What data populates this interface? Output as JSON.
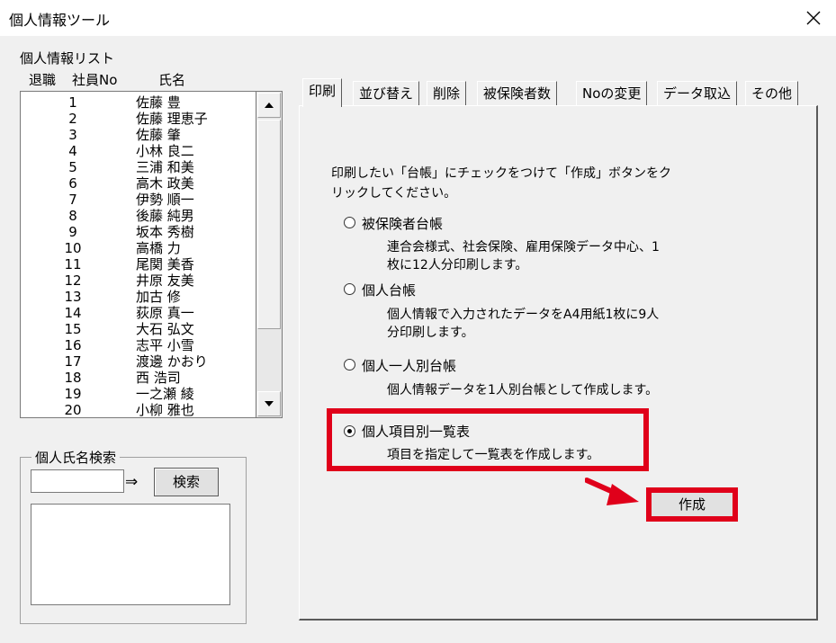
{
  "window": {
    "title": "個人情報ツール"
  },
  "list": {
    "title": "個人情報リスト",
    "columns": [
      "退職",
      "社員No",
      "氏名"
    ],
    "rows": [
      {
        "no": "1",
        "name": "佐藤 豊"
      },
      {
        "no": "2",
        "name": "佐藤 理恵子"
      },
      {
        "no": "3",
        "name": "佐藤 肇"
      },
      {
        "no": "4",
        "name": "小林 良二"
      },
      {
        "no": "5",
        "name": "三浦 和美"
      },
      {
        "no": "6",
        "name": "高木 政美"
      },
      {
        "no": "7",
        "name": "伊勢 順一"
      },
      {
        "no": "8",
        "name": "後藤 純男"
      },
      {
        "no": "9",
        "name": "坂本 秀樹"
      },
      {
        "no": "10",
        "name": "高橋 力"
      },
      {
        "no": "11",
        "name": "尾関 美香"
      },
      {
        "no": "12",
        "name": "井原 友美"
      },
      {
        "no": "13",
        "name": "加古 修"
      },
      {
        "no": "14",
        "name": "荻原 真一"
      },
      {
        "no": "15",
        "name": "大石 弘文"
      },
      {
        "no": "16",
        "name": "志平 小雪"
      },
      {
        "no": "17",
        "name": "渡邊 かおり"
      },
      {
        "no": "18",
        "name": "西 浩司"
      },
      {
        "no": "19",
        "name": "一之瀬 綾"
      },
      {
        "no": "20",
        "name": "小柳 雅也"
      }
    ]
  },
  "search": {
    "group_title": "個人氏名検索",
    "input_value": "",
    "arrow": "⇒",
    "button_label": "検索"
  },
  "tabs": [
    {
      "label": "印刷",
      "active": true
    },
    {
      "label": "並び替え"
    },
    {
      "label": "削除"
    },
    {
      "label": "被保険者数"
    },
    {
      "label": "Noの変更"
    },
    {
      "label": "データ取込"
    },
    {
      "label": "その他"
    }
  ],
  "print_panel": {
    "instruction_line1": "印刷したい「台帳」にチェックをつけて「作成」ボタンをク",
    "instruction_line2": "リックしてください。",
    "options": [
      {
        "label": "被保険者台帳",
        "desc_line1": "連合会様式、社会保険、雇用保険データ中心、1",
        "desc_line2": "枚に12人分印刷します。",
        "selected": false
      },
      {
        "label": "個人台帳",
        "desc_line1": "個人情報で入力されたデータをA4用紙1枚に9人",
        "desc_line2": "分印刷します。",
        "selected": false
      },
      {
        "label": "個人一人別台帳",
        "desc_line1": "個人情報データを1人別台帳として作成します。",
        "desc_line2": "",
        "selected": false
      },
      {
        "label": "個人項目別一覧表",
        "desc_line1": "項目を指定して一覧表を作成します。",
        "desc_line2": "",
        "selected": true
      }
    ],
    "create_button": "作成"
  },
  "colors": {
    "highlight": "#e0001a",
    "window_bg": "#f0f0f0"
  }
}
